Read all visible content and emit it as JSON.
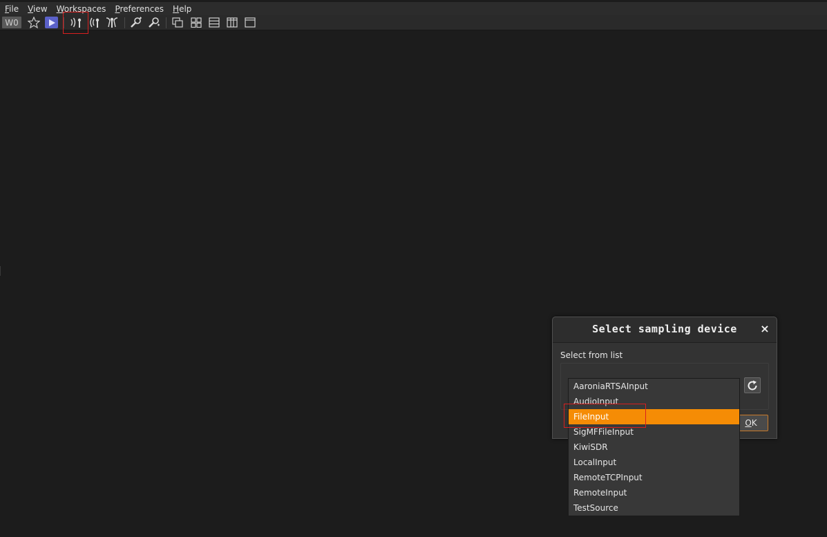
{
  "menubar": {
    "items": [
      {
        "first": "F",
        "rest": "ile"
      },
      {
        "first": "V",
        "rest": "iew"
      },
      {
        "first": "W",
        "rest": "orkspaces"
      },
      {
        "first": "P",
        "rest": "references"
      },
      {
        "first": "H",
        "rest": "elp"
      }
    ]
  },
  "toolbar": {
    "workspace_label": "W0",
    "icons": [
      "star-icon",
      "play-icon",
      "add-rx-device-icon",
      "add-tx-device-icon",
      "add-mimo-device-icon",
      "add-channel-wrench-icon",
      "add-feature-wrench-icon",
      "cascade-windows-icon",
      "tile-grid-icon",
      "stack-rows-icon",
      "spectrum-columns-icon",
      "single-window-icon"
    ],
    "highlighted": "add-rx-device-icon"
  },
  "dialog": {
    "title": "Select sampling device",
    "close_symbol": "×",
    "label": "Select from list",
    "ok_first": "O",
    "ok_rest": "K",
    "refresh_icon": "refresh-icon"
  },
  "device_list": {
    "items": [
      "AaroniaRTSAInput",
      "AudioInput",
      "FileInput",
      "SigMFFileInput",
      "KiwiSDR",
      "LocalInput",
      "RemoteTCPInput",
      "RemoteInput",
      "TestSource"
    ],
    "selected": "FileInput",
    "accent_color": "#f58c05"
  }
}
